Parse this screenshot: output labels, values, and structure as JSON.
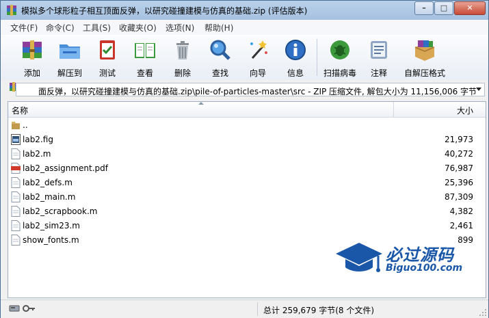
{
  "window": {
    "title": "模拟多个球形粒子相互顶面反弹，以研究碰撞建模与仿真的基础.zip (评估版本)"
  },
  "menu": [
    {
      "label": "文件(F)"
    },
    {
      "label": "命令(C)"
    },
    {
      "label": "工具(S)"
    },
    {
      "label": "收藏夹(O)"
    },
    {
      "label": "选项(N)"
    },
    {
      "label": "帮助(H)"
    }
  ],
  "toolbar": {
    "tools": [
      {
        "label": "添加",
        "icon": "add-archive-icon"
      },
      {
        "label": "解压到",
        "icon": "extract-folder-icon"
      },
      {
        "label": "测试",
        "icon": "test-checklist-icon"
      },
      {
        "label": "查看",
        "icon": "view-book-icon"
      },
      {
        "label": "删除",
        "icon": "trash-icon"
      },
      {
        "label": "查找",
        "icon": "find-magnifier-icon"
      },
      {
        "label": "向导",
        "icon": "wizard-wand-icon"
      },
      {
        "label": "信息",
        "icon": "info-icon"
      },
      {
        "label": "扫描病毒",
        "icon": "virus-scan-icon"
      },
      {
        "label": "注释",
        "icon": "comment-icon"
      },
      {
        "label": "自解压格式",
        "icon": "sfx-box-icon"
      }
    ]
  },
  "address": {
    "path": "面反弹，以研究碰撞建模与仿真的基础.zip\\pile-of-particles-master\\src - ZIP 压缩文件, 解包大小为 11,156,006 字节"
  },
  "list": {
    "columns": {
      "name": "名称",
      "size": "大小"
    },
    "rows": [
      {
        "name": "..",
        "size": "",
        "type": "folder-up"
      },
      {
        "name": "lab2.fig",
        "size": "21,973",
        "type": "fig"
      },
      {
        "name": "lab2.m",
        "size": "40,272",
        "type": "m"
      },
      {
        "name": "lab2_assignment.pdf",
        "size": "76,987",
        "type": "pdf"
      },
      {
        "name": "lab2_defs.m",
        "size": "25,396",
        "type": "m"
      },
      {
        "name": "lab2_main.m",
        "size": "87,309",
        "type": "m"
      },
      {
        "name": "lab2_scrapbook.m",
        "size": "4,382",
        "type": "m"
      },
      {
        "name": "lab2_sim23.m",
        "size": "2,461",
        "type": "m"
      },
      {
        "name": "show_fonts.m",
        "size": "899",
        "type": "m"
      }
    ]
  },
  "status": {
    "summary": "总计 259,679 字节(8 个文件)"
  },
  "watermark": {
    "brand": "必过源码",
    "url": "Biguo100.com"
  },
  "colors": {
    "accent": "#1a57a8",
    "titlebar": "#b9d1ea"
  }
}
